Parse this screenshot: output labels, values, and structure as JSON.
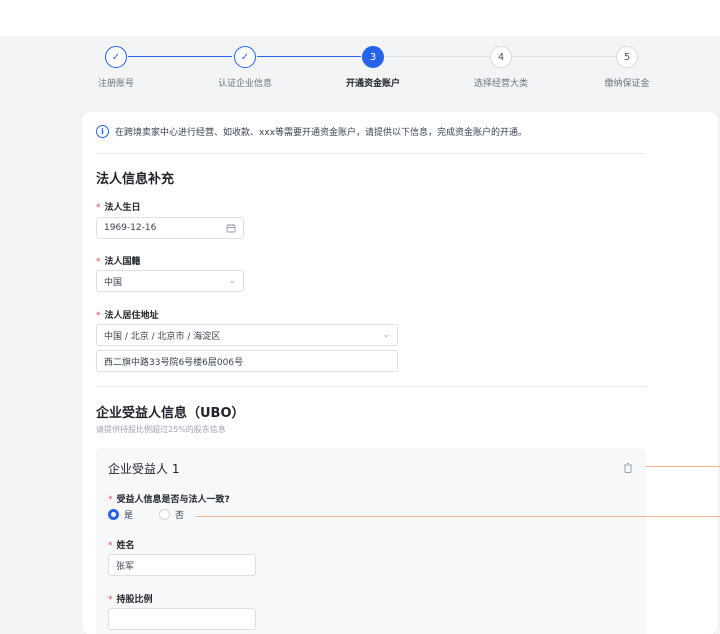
{
  "stepper": {
    "steps": [
      {
        "num": "✓",
        "label": "注册账号",
        "state": "done"
      },
      {
        "num": "✓",
        "label": "认证企业信息",
        "state": "done"
      },
      {
        "num": "3",
        "label": "开通资金账户",
        "state": "active"
      },
      {
        "num": "4",
        "label": "选择经营大类",
        "state": "todo"
      },
      {
        "num": "5",
        "label": "缴纳保证金",
        "state": "todo"
      }
    ]
  },
  "notice": {
    "icon": "info-icon",
    "text": "在跨境卖家中心进行经营、如收款、xxx等需要开通资金账户，请提供以下信息，完成资金账户的开通。"
  },
  "legal_rep": {
    "title": "法人信息补充",
    "birthday": {
      "label": "法人生日",
      "value": "1969-12-16"
    },
    "nationality": {
      "label": "法人国籍",
      "value": "中国"
    },
    "address": {
      "label": "法人居住地址",
      "region": "中国 / 北京 / 北京市 / 海淀区",
      "detail": "西二旗中路33号院6号楼6层006号"
    }
  },
  "ubo": {
    "title": "企业受益人信息（UBO）",
    "subtitle": "请提供持股比例超过25%的股东信息",
    "beneficiary": {
      "title": "企业受益人 1",
      "same_question": "受益人信息是否与法人一致?",
      "yes": "是",
      "no": "否",
      "selected": "是",
      "name_label": "姓名",
      "name_value": "张军",
      "share_label": "持股比例"
    }
  },
  "colors": {
    "primary": "#2563eb",
    "required": "#e5484d",
    "callout": "#f2b48a"
  }
}
